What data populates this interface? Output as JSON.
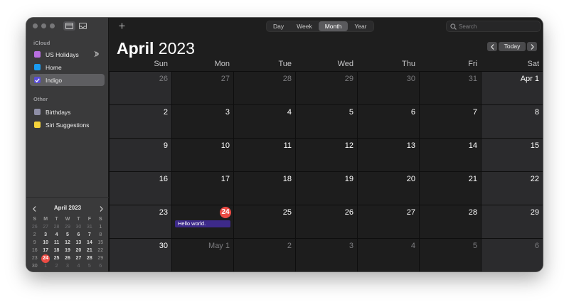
{
  "sidebar": {
    "sections": [
      {
        "title": "iCloud",
        "items": [
          {
            "label": "US Holidays",
            "color": "#b86fe0",
            "selected": false,
            "checked": false,
            "subscribed": true
          },
          {
            "label": "Home",
            "color": "#1a9bf0",
            "selected": false,
            "checked": false,
            "subscribed": false
          },
          {
            "label": "Indigo",
            "color": "#5a4fd8",
            "selected": true,
            "checked": true,
            "subscribed": false
          }
        ]
      },
      {
        "title": "Other",
        "items": [
          {
            "label": "Birthdays",
            "color": "#8e8ea6",
            "selected": false,
            "checked": false,
            "subscribed": false
          },
          {
            "label": "Siri Suggestions",
            "color": "#f5d33b",
            "selected": false,
            "checked": false,
            "subscribed": false
          }
        ]
      }
    ]
  },
  "mini_calendar": {
    "title": "April 2023",
    "weekdays": [
      "S",
      "M",
      "T",
      "W",
      "T",
      "F",
      "S"
    ],
    "weeks": [
      [
        "26",
        "27",
        "28",
        "29",
        "30",
        "31",
        "1"
      ],
      [
        "2",
        "3",
        "4",
        "5",
        "6",
        "7",
        "8"
      ],
      [
        "9",
        "10",
        "11",
        "12",
        "13",
        "14",
        "15"
      ],
      [
        "16",
        "17",
        "18",
        "19",
        "20",
        "21",
        "22"
      ],
      [
        "23",
        "24",
        "25",
        "26",
        "27",
        "28",
        "29"
      ],
      [
        "30",
        "1",
        "2",
        "3",
        "4",
        "5",
        "6"
      ]
    ],
    "today": "24"
  },
  "toolbar": {
    "views": [
      "Day",
      "Week",
      "Month",
      "Year"
    ],
    "active_view": "Month",
    "search_placeholder": "Search",
    "today_label": "Today"
  },
  "header": {
    "month": "April",
    "year": "2023"
  },
  "weekday_headers": [
    "Sun",
    "Mon",
    "Tue",
    "Wed",
    "Thu",
    "Fri",
    "Sat"
  ],
  "month_grid": [
    [
      "26",
      "27",
      "28",
      "29",
      "30",
      "31",
      "Apr 1"
    ],
    [
      "2",
      "3",
      "4",
      "5",
      "6",
      "7",
      "8"
    ],
    [
      "9",
      "10",
      "11",
      "12",
      "13",
      "14",
      "15"
    ],
    [
      "16",
      "17",
      "18",
      "19",
      "20",
      "21",
      "22"
    ],
    [
      "23",
      "24",
      "25",
      "26",
      "27",
      "28",
      "29"
    ],
    [
      "30",
      "May 1",
      "2",
      "3",
      "4",
      "5",
      "6"
    ]
  ],
  "today": {
    "week": 4,
    "day": 1
  },
  "events": [
    {
      "week": 4,
      "day": 1,
      "title": "Hello world.",
      "color": "#3d2a8a"
    }
  ]
}
